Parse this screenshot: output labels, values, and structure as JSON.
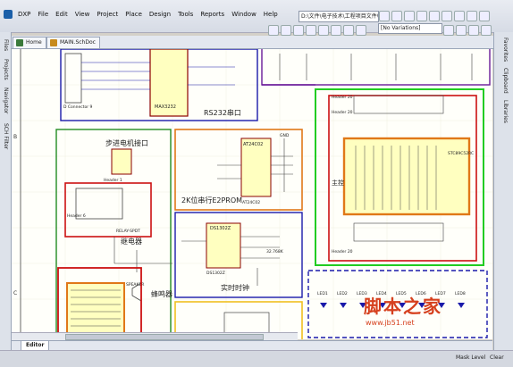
{
  "menu": {
    "items": [
      "DXP",
      "File",
      "Edit",
      "View",
      "Project",
      "Place",
      "Design",
      "Tools",
      "Reports",
      "Window",
      "Help"
    ]
  },
  "toolbar": {
    "path": "D:\\文件\\电子技术\\工程项目文件\\",
    "variations": "[No Variations]"
  },
  "tabs": [
    {
      "label": "Home"
    },
    {
      "label": "MAIN.SchDoc"
    }
  ],
  "left_panels": [
    "Files",
    "Projects",
    "Navigator",
    "SCH Filter"
  ],
  "right_panels": [
    "Favorites",
    "Clipboard",
    "Libraries"
  ],
  "editor_tab": "Editor",
  "status": {
    "mask_level": "Mask Level",
    "clear": "Clear"
  },
  "schematic": {
    "labels": {
      "rs232": "RS232串口",
      "stepper": "步进电机接口",
      "eeprom": "2K位串行E2PROM",
      "relay": "继电器",
      "buzzer": "蜂鸣器",
      "rtc": "实时时钟",
      "main": "主控"
    },
    "chips": {
      "max": "MAX3232",
      "at24": "AT24C02",
      "at24_ref": "AT24C02",
      "ds1302": "DS1302Z",
      "ds_ref": "DS1302Z",
      "stc": "STC89C52RC"
    },
    "headers": {
      "h1": "Header 1",
      "h2": "Header 6",
      "h3": "Header 20",
      "h4": "Header 20",
      "h5": "Header 20",
      "dconn": "D Connector 9",
      "speaker": "SPEAKER",
      "relay_part": "RELAY-SPDT",
      "gnd": "GND",
      "crystal": "32.768K"
    },
    "leds": [
      "LED1",
      "LED2",
      "LED3",
      "LED4",
      "LED5",
      "LED6",
      "LED7",
      "LED8"
    ]
  },
  "watermark": {
    "title": "脚本之家",
    "url": "www.jb51.net"
  },
  "colors": {
    "green_frame": "#22cc22",
    "orange_box": "#e07818",
    "red_box": "#cc1111",
    "blue_frame": "#1a1aaa",
    "purple_frame": "#6a1a9a",
    "chip_fill": "#ffffc0"
  }
}
